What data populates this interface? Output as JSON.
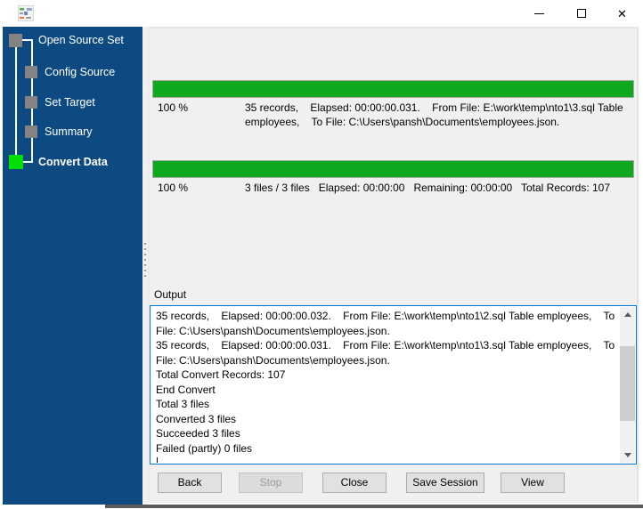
{
  "window": {
    "controls": {
      "minimize": "minimize",
      "maximize": "maximize",
      "close_glyph": "✕"
    }
  },
  "sidebar": {
    "items": [
      {
        "label": "Open Source Set",
        "state": "done"
      },
      {
        "label": "Config Source",
        "state": "done"
      },
      {
        "label": "Set Target",
        "state": "done"
      },
      {
        "label": "Summary",
        "state": "done"
      },
      {
        "label": "Convert Data",
        "state": "active"
      }
    ]
  },
  "file_progress": {
    "percent": "100 %",
    "value": 100,
    "detail": "35 records,    Elapsed: 00:00:00.031.    From File: E:\\work\\temp\\nto1\\3.sql Table employees,    To File: C:\\Users\\pansh\\Documents\\employees.json."
  },
  "total_progress": {
    "percent": "100 %",
    "value": 100,
    "detail": "3 files / 3 files   Elapsed: 00:00:00   Remaining: 00:00:00   Total Records: 107"
  },
  "output": {
    "label": "Output",
    "lines": [
      "35 records,    Elapsed: 00:00:00.032.    From File: E:\\work\\temp\\nto1\\2.sql Table employees,    To File: C:\\Users\\pansh\\Documents\\employees.json.",
      "35 records,    Elapsed: 00:00:00.031.    From File: E:\\work\\temp\\nto1\\3.sql Table employees,    To File: C:\\Users\\pansh\\Documents\\employees.json.",
      "Total Convert Records: 107",
      "End Convert",
      "Total 3 files",
      "Converted 3 files",
      "Succeeded 3 files",
      "Failed (partly) 0 files"
    ]
  },
  "buttons": [
    {
      "label": "Back",
      "enabled": true
    },
    {
      "label": "Stop",
      "enabled": false
    },
    {
      "label": "Close",
      "enabled": true
    },
    {
      "label": "Save Session",
      "enabled": true
    },
    {
      "label": "View",
      "enabled": true
    }
  ],
  "colors": {
    "sidebar_blue": "#0d4a81",
    "progress_green": "#0fa81e",
    "active_step_green": "#00df00",
    "inactive_step_gray": "#838383",
    "focus_border_blue": "#0078d7",
    "main_background": "#f0f0f0",
    "button_background": "#e1e1e1"
  }
}
